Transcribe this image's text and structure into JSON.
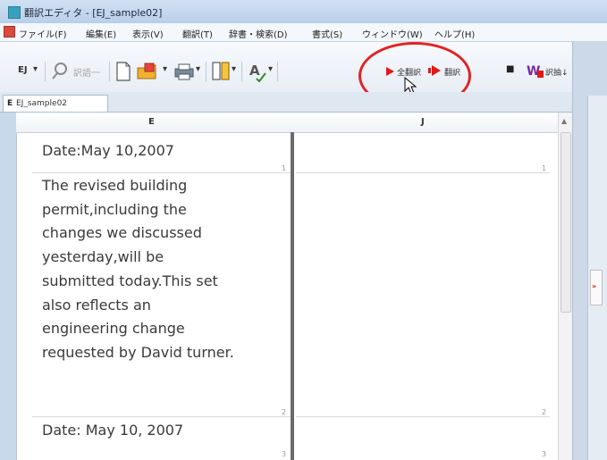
{
  "window": {
    "title": "翻訳エディタ - [EJ_sample02]"
  },
  "menu": {
    "items": [
      "ファイル(F)",
      "編集(E)",
      "表示(V)",
      "翻訳(T)",
      "辞書・検索(D)",
      "書式(S)",
      "ウィンドウ(W)",
      "ヘルプ(H)"
    ]
  },
  "toolbar": {
    "direction_label": "EJ",
    "dropdown_glyph": "▾",
    "search_label": "訳語一",
    "translate_all_label": "全翻訳",
    "translate_label": "翻訳",
    "stop_glyph": "■",
    "dict_label": "訳抽↓"
  },
  "tab": {
    "type": "E",
    "label": "EJ_sample02"
  },
  "columns": {
    "source_header": "E",
    "target_header": "J"
  },
  "segments": [
    {
      "num": "1",
      "source": [
        "Date:May 10,2007"
      ],
      "target_num": "1"
    },
    {
      "num": "2",
      "source": [
        "The revised building",
        "permit,including the",
        "changes we discussed",
        "yesterday,will be",
        "submitted today.This set",
        "also reflects an",
        "engineering change",
        "requested by David turner."
      ],
      "target_num": "2"
    },
    {
      "num": "3",
      "source": [
        "Date: May 10, 2007"
      ],
      "target_num": "3"
    }
  ],
  "icons": [
    "app-icon",
    "document-icon",
    "search-icon",
    "new-document-icon",
    "open-folder-icon",
    "print-icon",
    "layout-icon",
    "proofread-icon",
    "translate-all-icon",
    "translate-icon",
    "stop-icon",
    "dictionary-extract-icon",
    "mouse-cursor-icon"
  ],
  "colors": {
    "accent_red": "#e01818",
    "highlight_circle": "#e02424",
    "title_bar": "#c9d9ec"
  }
}
